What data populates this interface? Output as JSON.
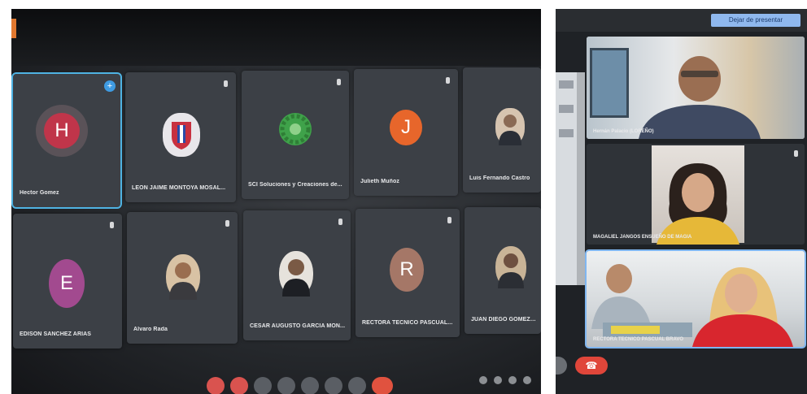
{
  "left_grid": {
    "tiles": [
      {
        "name": "Hector Gomez",
        "initial": "H",
        "avatar_color": "#c0354a",
        "ring_color": "#5a5258"
      },
      {
        "name": "LEON JAIME MONTOYA MOSAL...",
        "initial": "",
        "avatar_color": "#e8e6ea"
      },
      {
        "name": "SCI Soluciones y Creaciones de...",
        "initial": "",
        "avatar_color": "#3fa24a"
      },
      {
        "name": "Julieth Muñoz",
        "initial": "J",
        "avatar_color": "#e7662b"
      },
      {
        "name": "Luis Fernando Castro",
        "initial": "",
        "avatar_color": "#d6c4b0"
      },
      {
        "name": "EDISON SANCHEZ ARIAS",
        "initial": "E",
        "avatar_color": "#a24a8f"
      },
      {
        "name": "Alvaro Rada",
        "initial": "",
        "avatar_color": "#d8c2a4"
      },
      {
        "name": "CESAR AUGUSTO GARCIA MON...",
        "initial": "",
        "avatar_color": "#e6e2dc"
      },
      {
        "name": "RECTORA TECNICO PASCUAL...",
        "initial": "R",
        "avatar_color": "#a57767"
      },
      {
        "name": "JUAN DIEGO GOMEZ BEDOYA",
        "initial": "",
        "avatar_color": "#c9b497"
      }
    ]
  },
  "right_panel": {
    "stop_presenting_label": "Dejar de presentar",
    "feeds": [
      {
        "name": "Hernán Palacio (LOREÑO)"
      },
      {
        "name": "MAGALIEL JANGOS ENSUEÑO DE MAGIA"
      },
      {
        "name": "RECTORA TECNICO PASCUAL BRAVO"
      }
    ],
    "end_call_icon": "phone-hangup-icon"
  },
  "colors": {
    "accent_blue": "#4fb3e3",
    "end_call_red": "#e0463a"
  }
}
